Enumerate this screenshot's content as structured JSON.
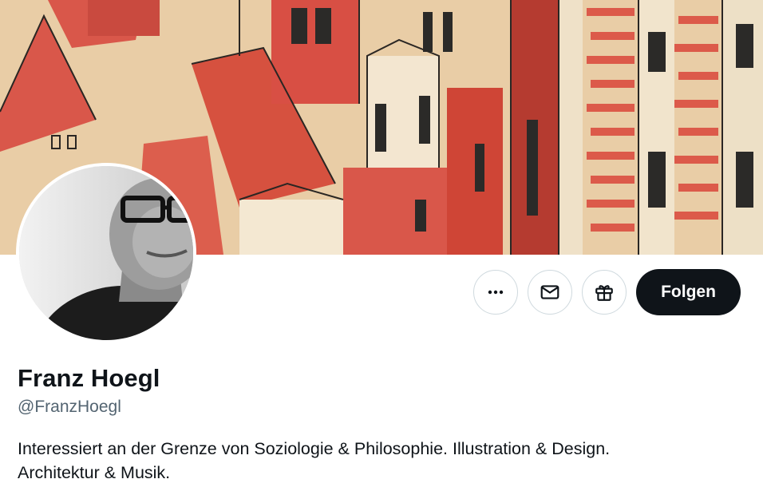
{
  "profile": {
    "name": "Franz Hoegl",
    "handle": "@FranzHoegl",
    "bio_line1": "Interessiert an der Grenze von Soziologie & Philosophie. Illustration & Design.",
    "bio_line2": "Architektur & Musik."
  },
  "actions": {
    "more_icon": "more-horizontal-icon",
    "message_icon": "envelope-icon",
    "gift_icon": "gift-icon",
    "follow_label": "Folgen"
  },
  "colors": {
    "text_primary": "#0f1419",
    "text_secondary": "#536471",
    "button_border": "#cfd9de",
    "follow_bg": "#0f1419",
    "banner_red": "#d9574a",
    "banner_paper": "#e7c79c"
  }
}
